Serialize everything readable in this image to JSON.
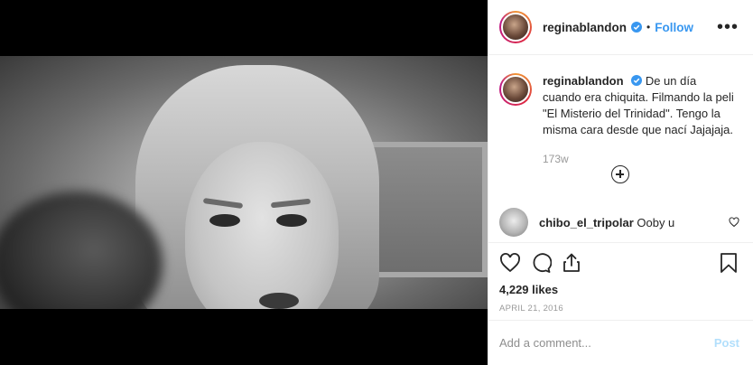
{
  "post": {
    "username": "reginablandon",
    "follow_label": "Follow",
    "dot": "•",
    "more_icon_text": "•••"
  },
  "caption": {
    "username": "reginablandon",
    "text": "De un día cuando era chiquita. Filmando la peli \"El Misterio del Trinidad\". Tengo la misma cara desde que nací Jajajaja.",
    "time_ago": "173w"
  },
  "comment": {
    "username": "chibo_el_tripolar",
    "text": "Ooby u"
  },
  "stats": {
    "likes": "4,229 likes",
    "date": "APRIL 21, 2016"
  },
  "add_comment": {
    "placeholder": "Add a comment...",
    "post_label": "Post"
  },
  "colors": {
    "accent": "#3897f0",
    "post_disabled": "#b2dffc"
  },
  "icons": [
    "verified-badge-icon",
    "more-options-icon",
    "load-more-icon",
    "heart-icon",
    "comment-icon",
    "share-icon",
    "bookmark-icon"
  ]
}
